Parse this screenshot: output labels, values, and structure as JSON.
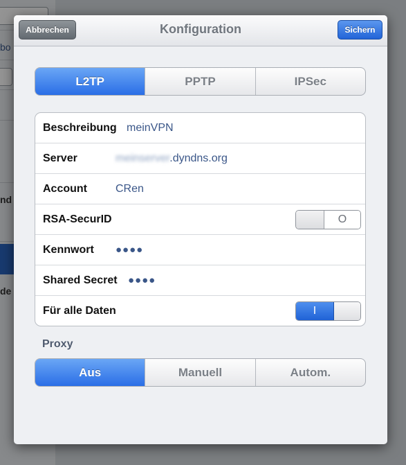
{
  "modal": {
    "title": "Konfiguration",
    "cancel_label": "Abbrechen",
    "save_label": "Sichern"
  },
  "vpn_type": {
    "options": [
      "L2TP",
      "PPTP",
      "IPSec"
    ],
    "selected": "L2TP"
  },
  "fields": {
    "beschreibung": {
      "label": "Beschreibung",
      "value": "meinVPN"
    },
    "server": {
      "label": "Server",
      "value_blurred": "meinserver",
      "value": ".dyndns.org"
    },
    "account": {
      "label": "Account",
      "value": "CRen"
    },
    "rsa": {
      "label": "RSA-SecurID",
      "state": "off",
      "glyph": "O"
    },
    "kennwort": {
      "label": "Kennwort",
      "value": "●●●●"
    },
    "shared_secret": {
      "label": "Shared Secret",
      "value": "●●●●"
    },
    "alle_daten": {
      "label": "Für alle Daten",
      "state": "on",
      "glyph": "I"
    }
  },
  "proxy": {
    "section_label": "Proxy",
    "options": [
      "Aus",
      "Manuell",
      "Autom."
    ],
    "selected": "Aus"
  },
  "background": {
    "partial_texts": [
      "bo",
      "nd",
      "de"
    ]
  },
  "colors": {
    "accent": "#2a6ee6",
    "value_text": "#3a5688"
  }
}
